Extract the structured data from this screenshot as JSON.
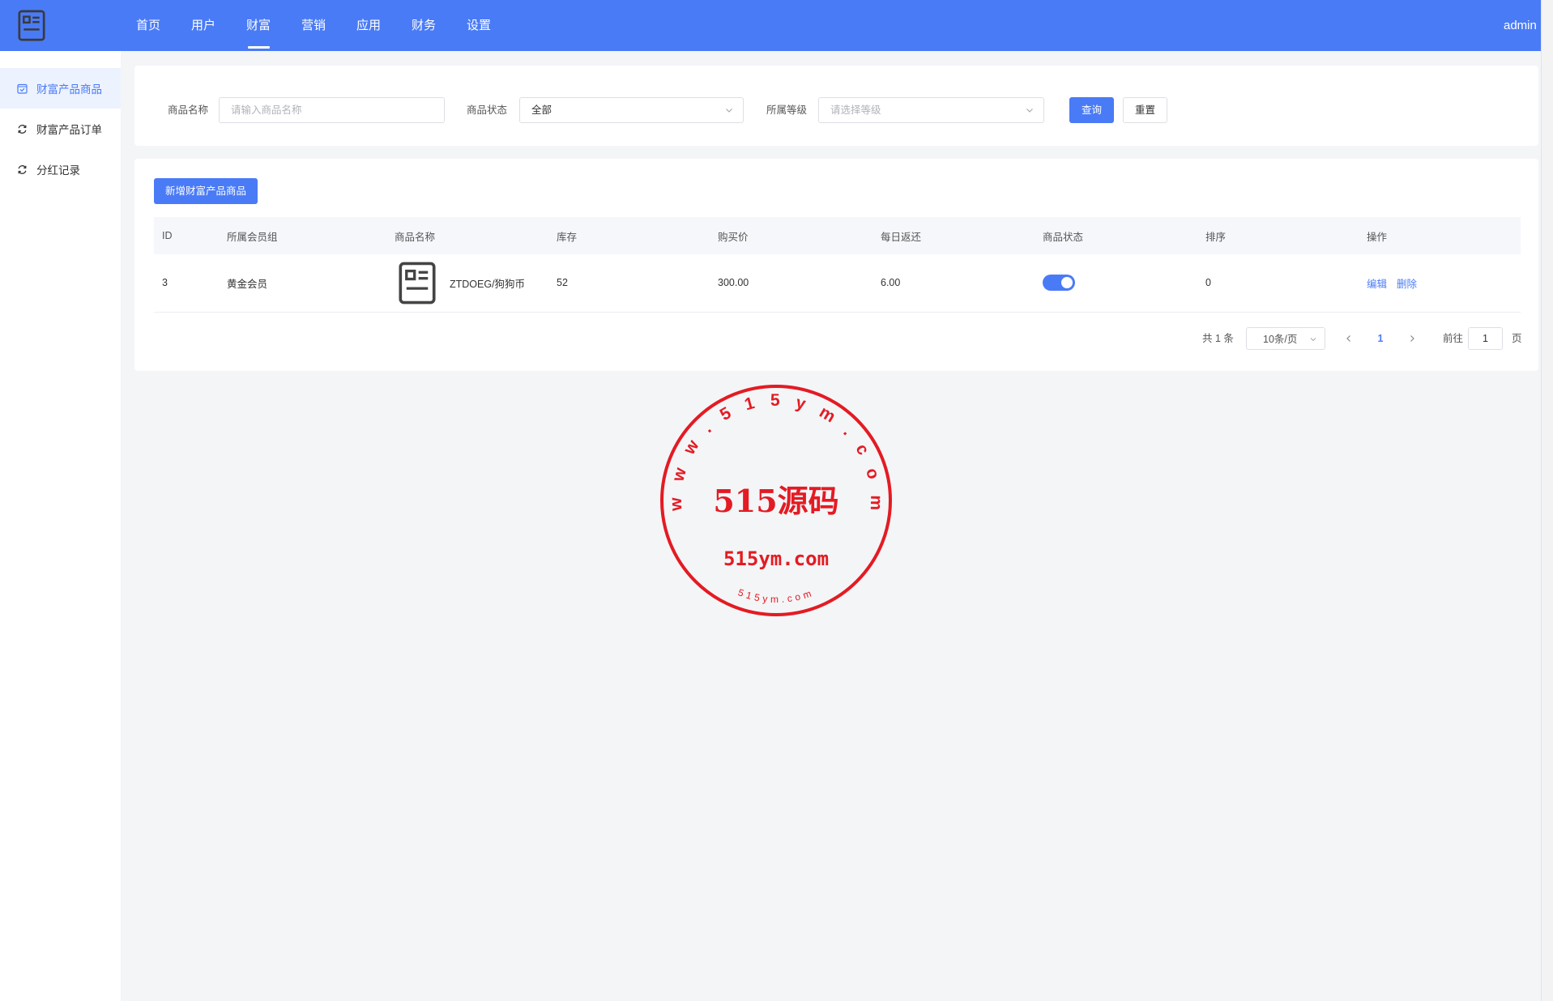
{
  "header": {
    "nav": [
      {
        "label": "首页"
      },
      {
        "label": "用户"
      },
      {
        "label": "财富",
        "active": true
      },
      {
        "label": "营销"
      },
      {
        "label": "应用"
      },
      {
        "label": "财务"
      },
      {
        "label": "设置"
      }
    ],
    "user": "admin",
    "logo_icon": "document-icon"
  },
  "sidebar": {
    "items": [
      {
        "label": "财富产品商品",
        "icon": "checkbox-icon",
        "active": true
      },
      {
        "label": "财富产品订单",
        "icon": "refresh-icon"
      },
      {
        "label": "分红记录",
        "icon": "refresh-icon"
      }
    ]
  },
  "filter": {
    "name_label": "商品名称",
    "name_placeholder": "请输入商品名称",
    "status_label": "商品状态",
    "status_value": "全部",
    "level_label": "所属等级",
    "level_placeholder": "请选择等级",
    "query_label": "查询",
    "reset_label": "重置"
  },
  "table": {
    "add_button": "新增财富产品商品",
    "columns": [
      "ID",
      "所属会员组",
      "商品名称",
      "库存",
      "购买价",
      "每日返还",
      "商品状态",
      "排序",
      "操作"
    ],
    "rows": [
      {
        "id": "3",
        "group": "黄金会员",
        "image_icon": "document-icon",
        "name": "ZTDOEG/狗狗币",
        "stock": "52",
        "price": "300.00",
        "daily_return": "6.00",
        "status_enabled": true,
        "sort": "0",
        "actions": [
          "编辑",
          "删除"
        ]
      }
    ]
  },
  "pagination": {
    "total": "共 1 条",
    "page_size": "10条/页",
    "current_page": "1",
    "goto_label": "前往",
    "goto_value": "1",
    "page_suffix": "页"
  },
  "watermark": {
    "ring_text": "www.515ym.com",
    "title": "515源码",
    "domain": "515ym.com",
    "bottom_text": "515ym.com"
  },
  "colors": {
    "primary": "#4a7bf6",
    "sidebar_active_bg": "#ecf2fe",
    "watermark": "#e31b23"
  }
}
